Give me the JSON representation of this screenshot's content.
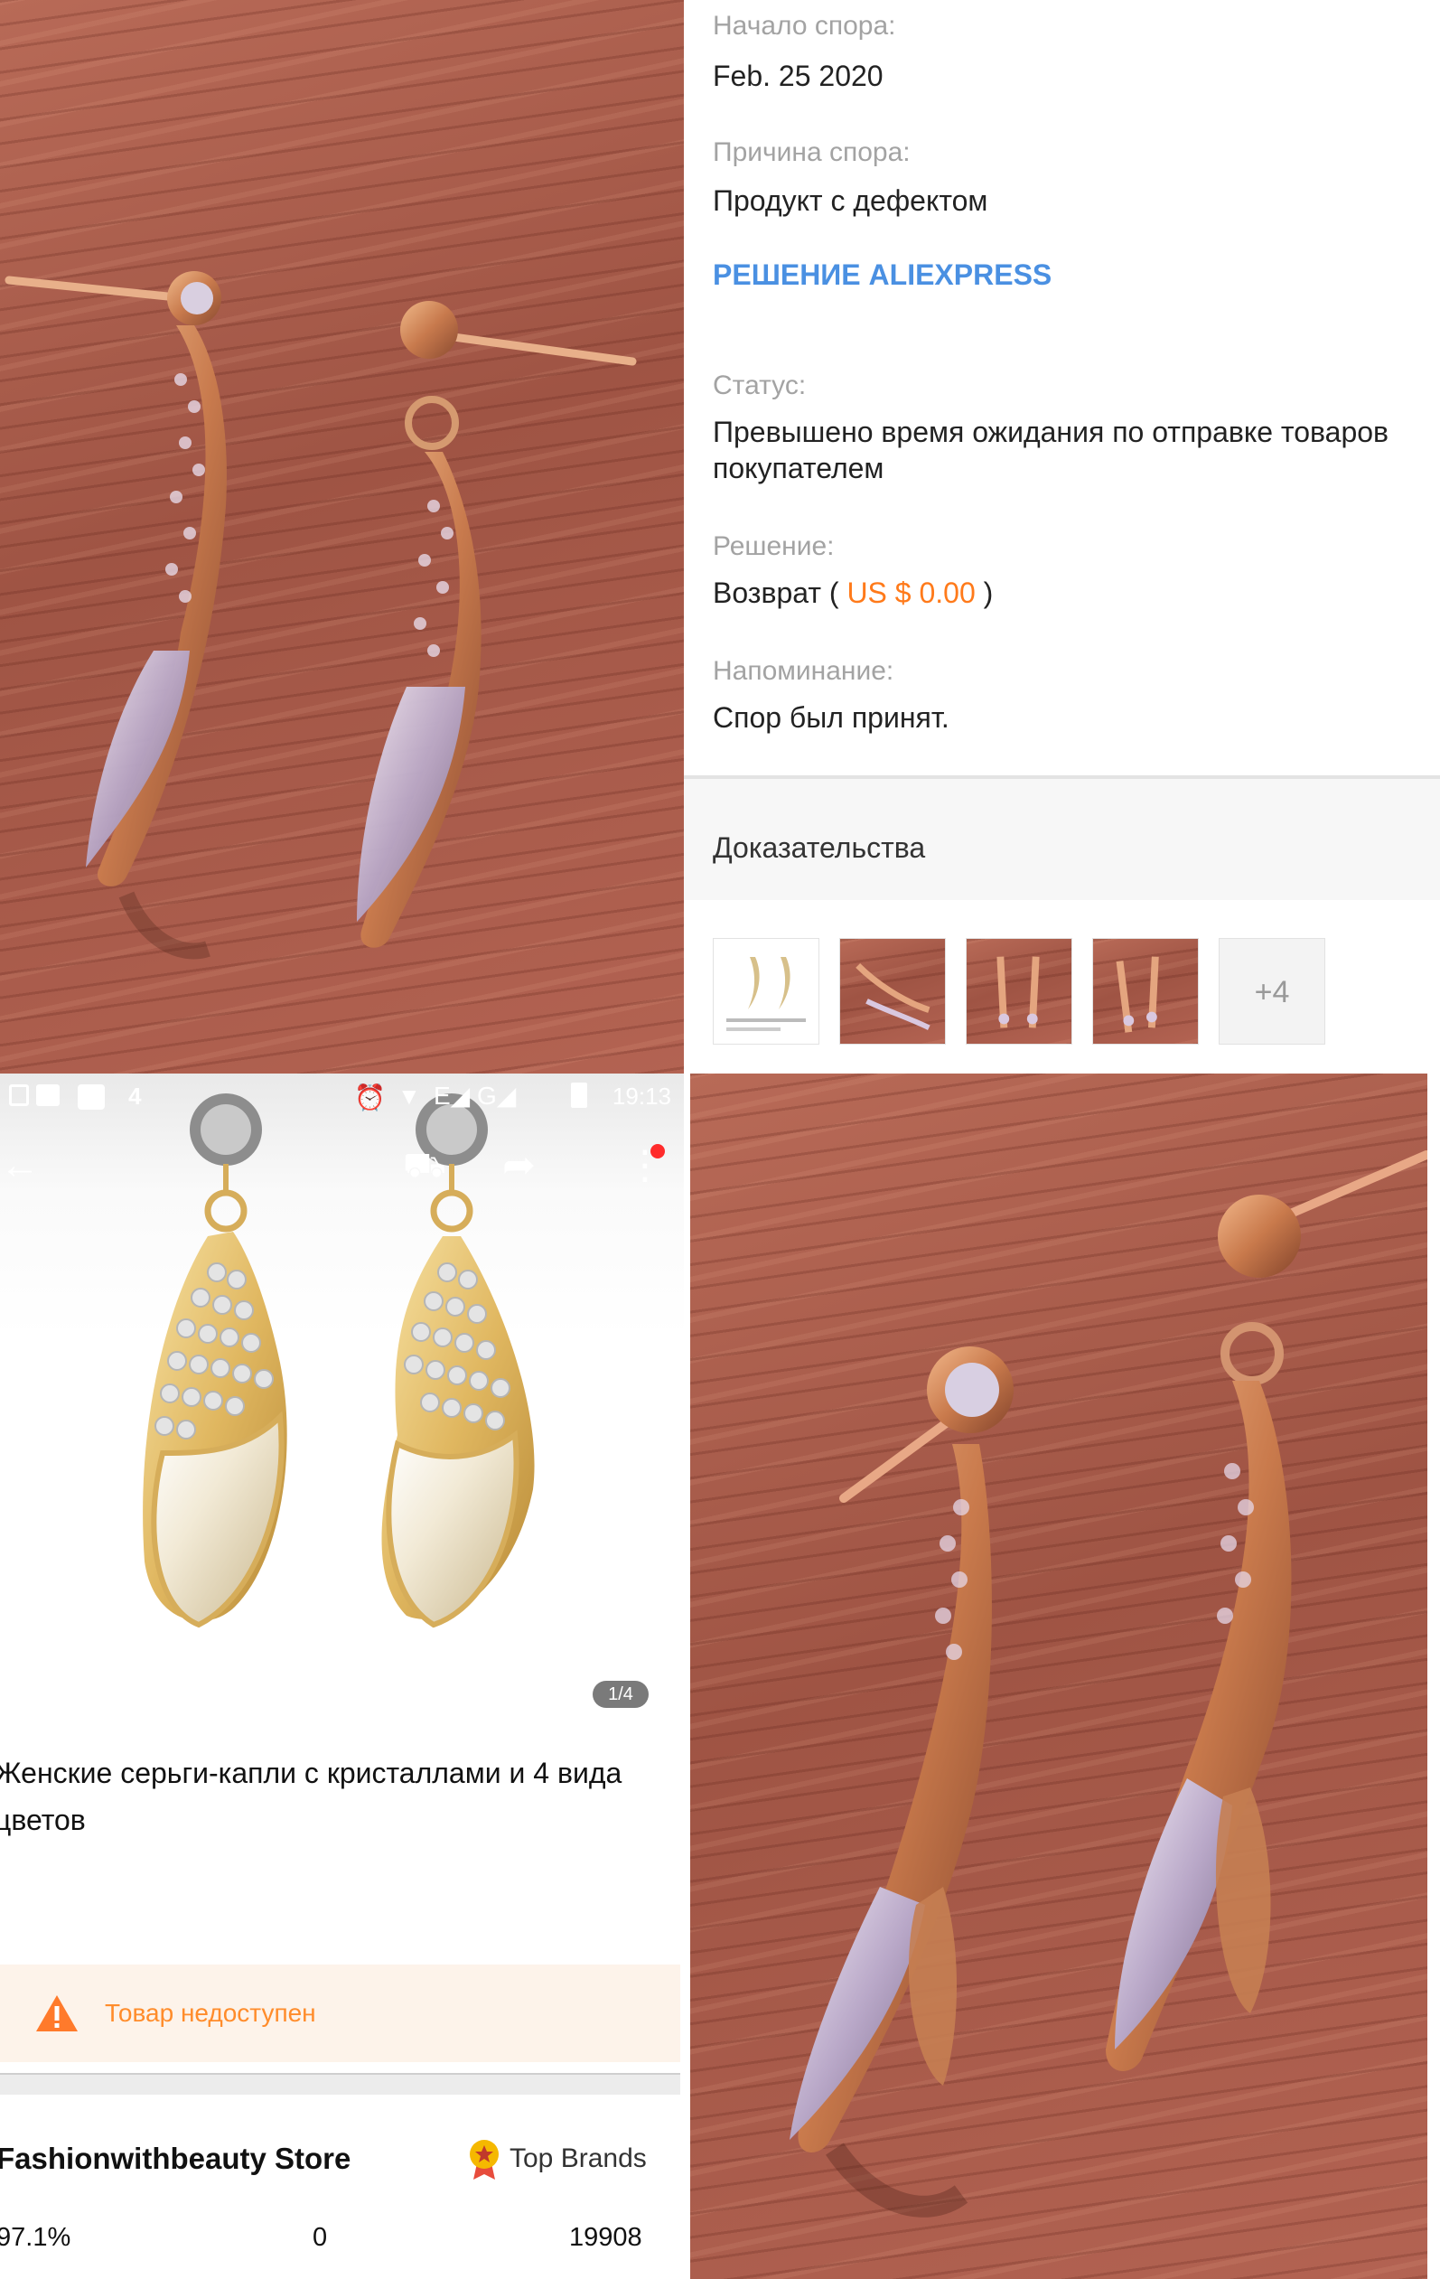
{
  "dispute": {
    "start_label": "Начало спора:",
    "start_value": "Feb. 25 2020",
    "reason_label": "Причина спора:",
    "reason_value": "Продукт с дефектом",
    "aliexpress_decision": "РЕШЕНИЕ ALIEXPRESS",
    "status_label": "Статус:",
    "status_value": "Превышено время ожидания по отправке товаров покупателем",
    "resolution_label": "Решение:",
    "resolution_prefix": "Возврат (",
    "resolution_amount": "US $ 0.00",
    "resolution_suffix": ")",
    "reminder_label": "Напоминание:",
    "reminder_value": "Спор был принят.",
    "evidence_title": "Доказательства",
    "evidence_more": "+4"
  },
  "phone": {
    "status_time": "19:13",
    "status_notif": "4",
    "image_counter": "1/4",
    "product_title": "Женские серьги-капли с кристаллами и 4 вида цветов",
    "unavailable_text": "Товар недоступен",
    "store_name": "Fashionwithbeauty Store",
    "store_badge": "Top Brands",
    "stats": {
      "positive_feedback": "97.1%",
      "middle_value": "0",
      "followers": "19908"
    }
  },
  "colors": {
    "link_blue": "#4a90e2",
    "price_orange": "#ff7a1a",
    "warning_orange": "#ff8c2b",
    "label_gray": "#a3a3a3"
  },
  "icons": [
    "back-arrow-icon",
    "cart-icon",
    "share-icon",
    "more-vert-icon",
    "warning-icon",
    "medal-icon"
  ]
}
